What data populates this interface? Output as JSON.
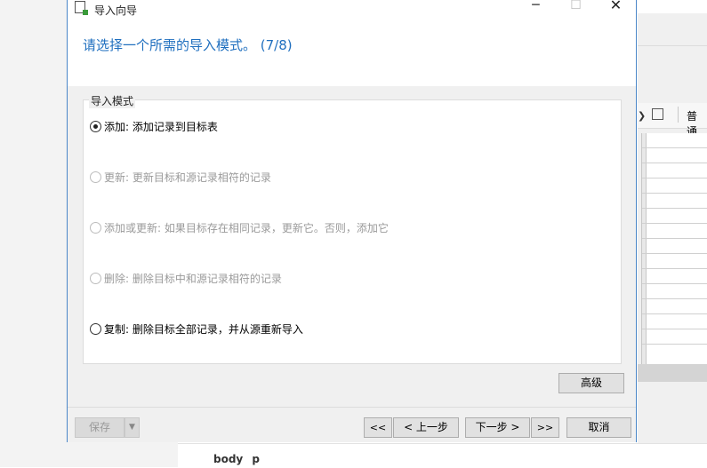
{
  "background": {
    "toolbar_text": "普通",
    "breadcrumb": "body  p"
  },
  "dialog": {
    "title": "导入向导",
    "header_title": "请选择一个所需的导入模式。 (7/8)",
    "group_title": "导入模式",
    "options": [
      {
        "label": "添加: 添加记录到目标表",
        "checked": true,
        "enabled": true
      },
      {
        "label": "更新: 更新目标和源记录相符的记录",
        "checked": false,
        "enabled": false
      },
      {
        "label": "添加或更新: 如果目标存在相同记录，更新它。否则，添加它",
        "checked": false,
        "enabled": false
      },
      {
        "label": "删除: 删除目标中和源记录相符的记录",
        "checked": false,
        "enabled": false
      },
      {
        "label": "复制: 删除目标全部记录，并从源重新导入",
        "checked": false,
        "enabled": true
      }
    ],
    "advanced_button": "高级",
    "footer": {
      "save": "保存",
      "first": "<<",
      "prev": "< 上一步",
      "next": "下一步 >",
      "last": ">>",
      "cancel": "取消"
    }
  },
  "icons": {
    "minimize": "minimize-icon",
    "maximize": "maximize-icon",
    "close": "close-icon",
    "app": "import-wizard-icon",
    "dropdown": "dropdown-arrow-icon"
  },
  "colors": {
    "header_title": "#1f6fbf",
    "window_border": "#4a86c8",
    "dialog_bg": "#f0f0f0"
  }
}
